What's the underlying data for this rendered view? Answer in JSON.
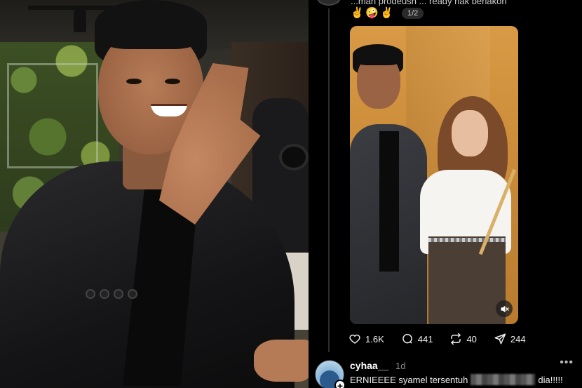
{
  "left_photo": {
    "alt": "Man in black suit gesturing with hand"
  },
  "post": {
    "caption": "...mah prodeush ... ready nak berlakon",
    "emoji": [
      "✌️",
      "🤪",
      "✌️"
    ],
    "pager": "1/2",
    "image_alt": "Video still of man in grey suit and woman in white blouse",
    "actions": {
      "likes": "1.6K",
      "comments": "441",
      "reposts": "40",
      "shares": "244"
    }
  },
  "reply": {
    "username": "cyhaa__",
    "time": "1d",
    "more": "•••",
    "text_before": "ERNIEEEE  syamel tersentuh",
    "text_after": "dia!!!!!"
  },
  "colors": {
    "background": "#000000",
    "text": "#f3f3f3",
    "muted": "#8a8a8a"
  }
}
